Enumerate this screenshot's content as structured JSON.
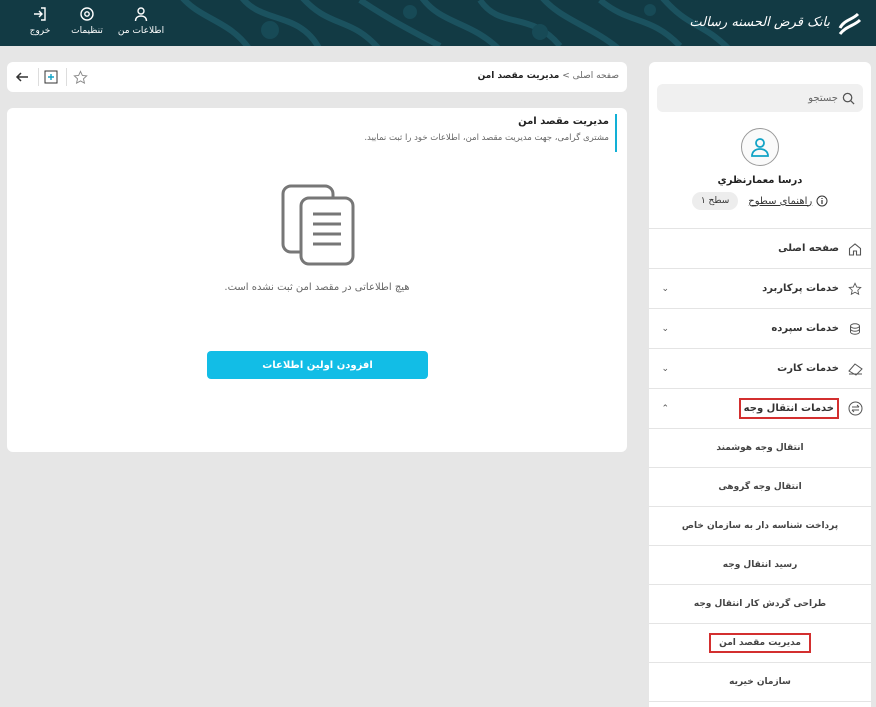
{
  "header": {
    "brand_name": "بانک قرض الحسنه رسالت",
    "buttons": [
      {
        "label": "خروج",
        "icon": "logout-icon"
      },
      {
        "label": "تنظیمات",
        "icon": "gear-icon"
      },
      {
        "label": "اطلاعات من",
        "icon": "user-icon"
      }
    ]
  },
  "toolbar": {
    "breadcrumb_home": "صفحه اصلی",
    "breadcrumb_sep": ">",
    "breadcrumb_current": "مدیریت مقصد امن"
  },
  "card": {
    "title": "مدیریت مقصد امن",
    "subtitle": "مشتری گرامی، جهت مدیریت مقصد امن، اطلاعات خود را ثبت نمایید.",
    "empty_message": "هیچ اطلاعاتی در مقصد امن ثبت نشده است.",
    "add_button": "افزودن اولین اطلاعات"
  },
  "sidebar": {
    "search_placeholder": "جستجو",
    "user_name": "درسا معمارنظري",
    "level_guide": "راهنمای سطوح",
    "level_badge": "سطح ۱",
    "menu": [
      {
        "label": "صفحه اصلی",
        "icon": "home-icon",
        "expandable": false
      },
      {
        "label": "خدمات پرکاربرد",
        "icon": "star-icon",
        "expandable": true
      },
      {
        "label": "خدمات سپرده",
        "icon": "coins-icon",
        "expandable": true
      },
      {
        "label": "خدمات کارت",
        "icon": "card-icon",
        "expandable": true
      },
      {
        "label": "خدمات انتقال وجه",
        "icon": "transfer-icon",
        "expandable": true,
        "expanded": true
      }
    ],
    "submenu": [
      {
        "label": "انتقال وجه هوشمند"
      },
      {
        "label": "انتقال وجه گروهی"
      },
      {
        "label": "پرداخت شناسه دار به سازمان خاص"
      },
      {
        "label": "رسید انتقال وجه"
      },
      {
        "label": "طراحی گردش کار انتقال وجه"
      },
      {
        "label": "مدیریت مقصد امن",
        "active": true
      },
      {
        "label": "سازمان خیریه"
      }
    ]
  },
  "colors": {
    "header_bg": "#123a44",
    "accent": "#12bde6",
    "highlight_border": "#d32f2f"
  }
}
